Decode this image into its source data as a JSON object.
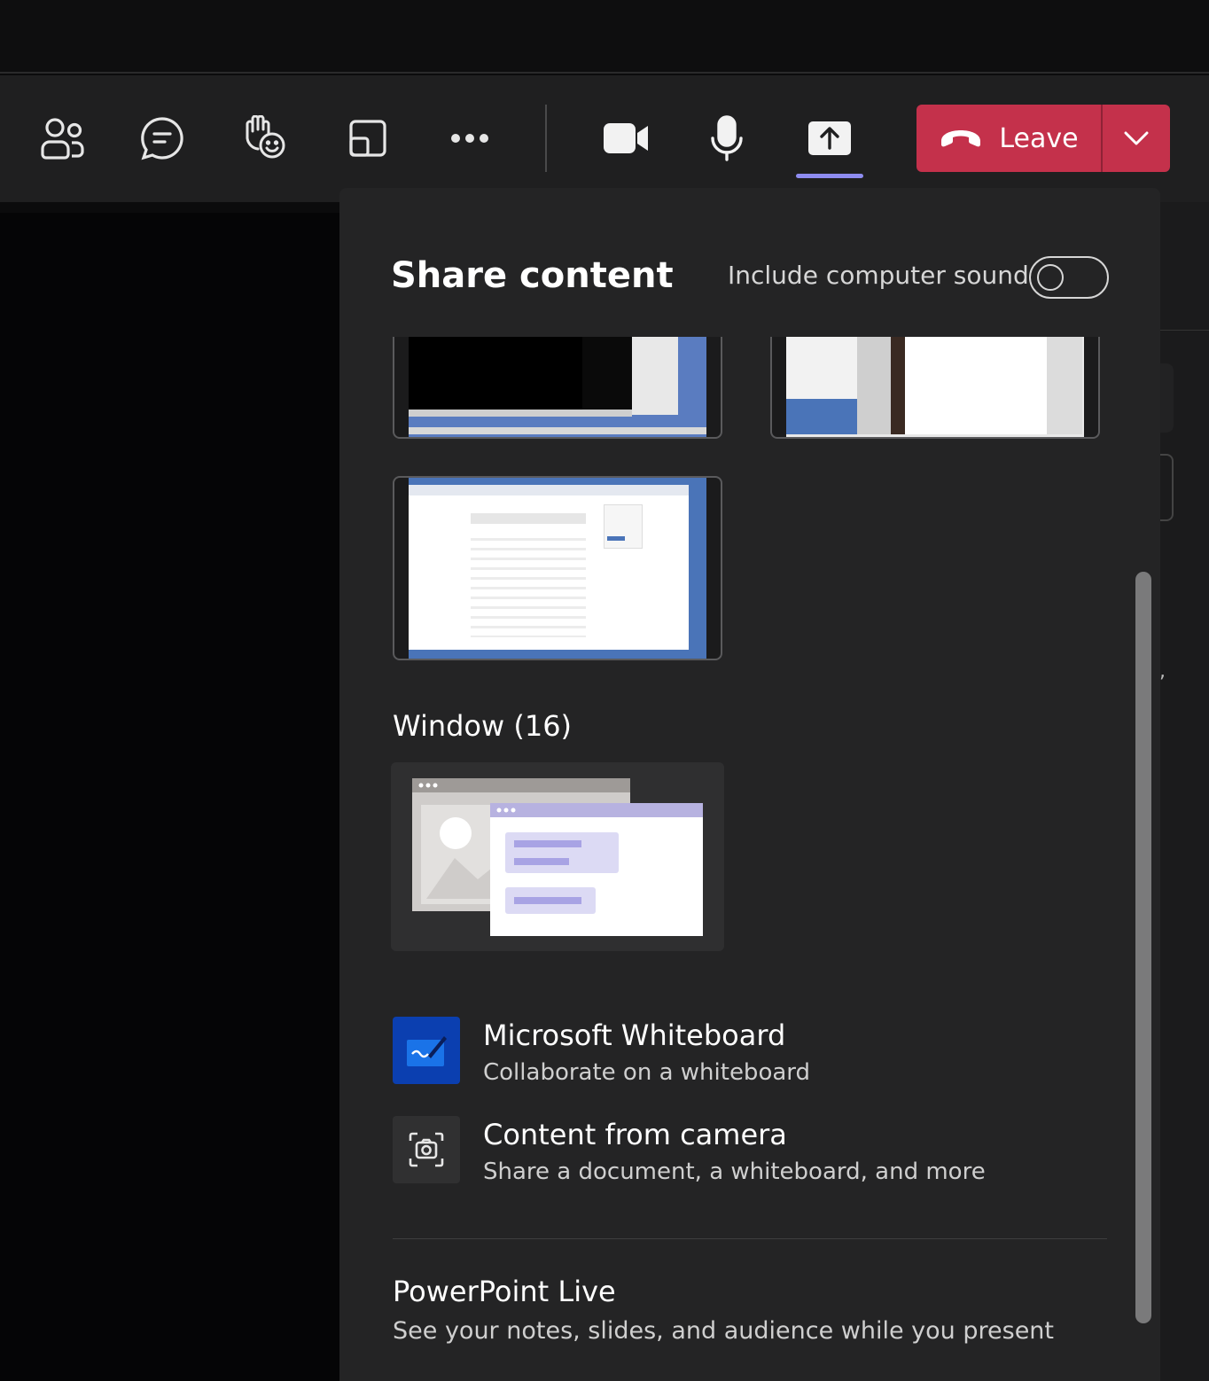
{
  "toolbar": {
    "items": [
      {
        "name": "people-icon"
      },
      {
        "name": "chat-icon"
      },
      {
        "name": "react-icon"
      },
      {
        "name": "view-icon"
      },
      {
        "name": "more-icon"
      },
      {
        "name": "camera-icon"
      },
      {
        "name": "mic-icon"
      },
      {
        "name": "share-icon",
        "active": true
      }
    ],
    "leave_label": "Leave"
  },
  "colors": {
    "accent": "#8e8cf0",
    "leave": "#c4314b",
    "panel": "#242425"
  },
  "share_panel": {
    "title": "Share content",
    "include_sound_label": "Include computer sound",
    "include_sound_on": false,
    "window_section": "Window (16)",
    "options": [
      {
        "icon": "whiteboard-icon",
        "title": "Microsoft Whiteboard",
        "subtitle": "Collaborate on a whiteboard"
      },
      {
        "icon": "camera-content-icon",
        "title": "Content from camera",
        "subtitle": "Share a document, a whiteboard, and more"
      }
    ],
    "ppt_title": "PowerPoint Live",
    "ppt_subtitle": "See your notes, slides, and audience while you present"
  }
}
